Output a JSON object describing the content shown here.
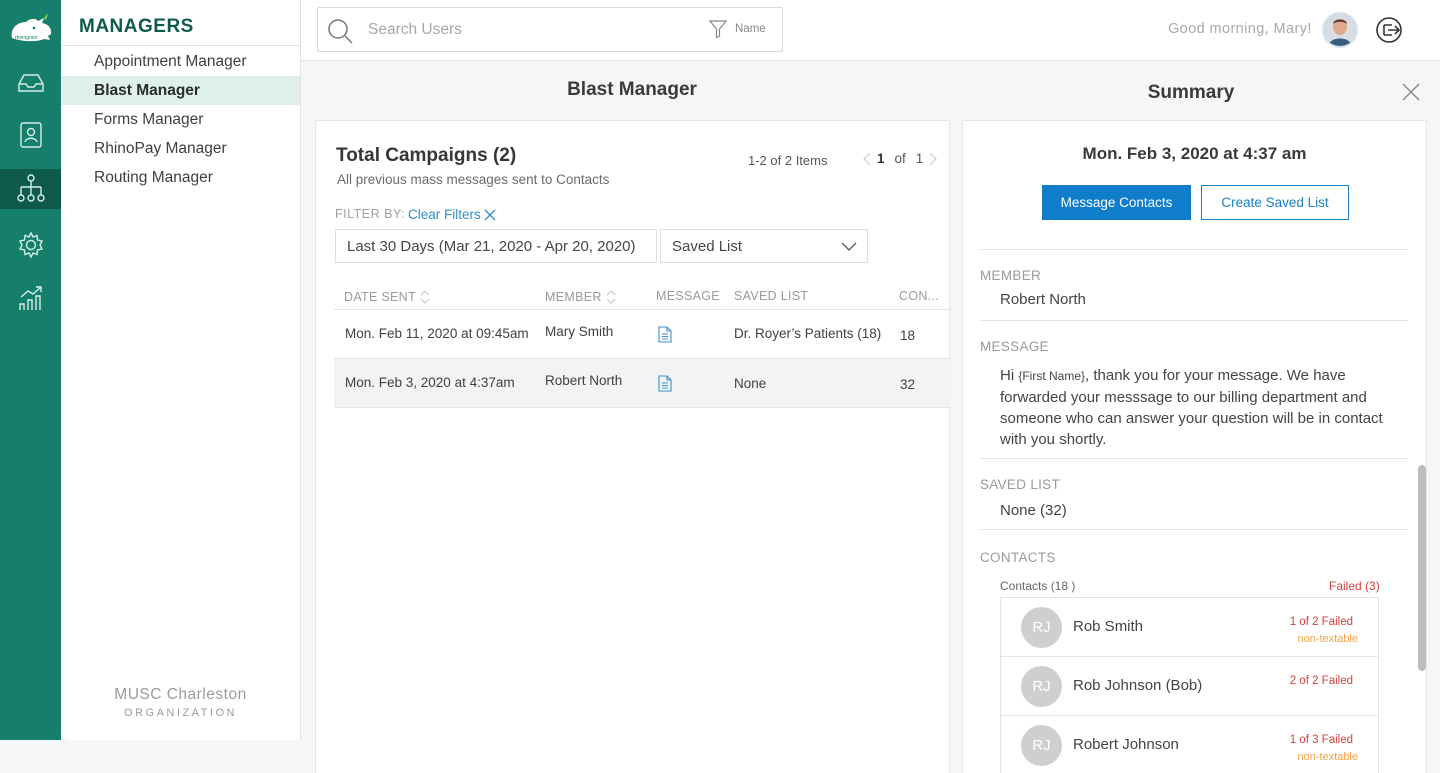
{
  "app": {
    "logo_text": "rhinogram"
  },
  "rail": {
    "items": [
      {
        "icon": "inbox-icon"
      },
      {
        "icon": "contacts-icon"
      },
      {
        "icon": "org-chart-icon",
        "active": true
      },
      {
        "icon": "gear-icon"
      },
      {
        "icon": "analytics-icon"
      }
    ]
  },
  "managers": {
    "title": "MANAGERS",
    "items": [
      {
        "label": "Appointment Manager"
      },
      {
        "label": "Blast Manager",
        "active": true
      },
      {
        "label": "Forms Manager"
      },
      {
        "label": "RhinoPay Manager"
      },
      {
        "label": "Routing Manager"
      }
    ],
    "org_name": "MUSC Charleston",
    "org_label": "ORGANIZATION"
  },
  "header": {
    "search_placeholder": "Search Users",
    "filter_label": "Name",
    "greeting": "Good morning, Mary!"
  },
  "blast": {
    "title": "Blast Manager",
    "card_title": "Total Campaigns (2)",
    "card_subtitle": "All previous mass messages sent to Contacts",
    "pager_text": "1-2 of 2 Items",
    "page_current": "1",
    "page_of": "of",
    "page_total": "1",
    "filter_by": "FILTER BY:",
    "clear_filters": "Clear Filters",
    "date_range": "Last 30 Days (Mar 21, 2020 - Apr 20, 2020)",
    "saved_list_select": "Saved List",
    "columns": {
      "date_sent": "DATE SENT",
      "member": "MEMBER",
      "message": "MESSAGE",
      "saved_list": "SAVED LIST",
      "contacts": "CON..."
    },
    "rows": [
      {
        "date": "Mon. Feb 11, 2020 at 09:45am",
        "member": "Mary Smith",
        "saved_list": "Dr. Royer’s Patients (18)",
        "contacts": "18"
      },
      {
        "date": "Mon. Feb 3, 2020 at 4:37am",
        "member": "Robert North",
        "saved_list": "None",
        "contacts": "32"
      }
    ]
  },
  "summary": {
    "title": "Summary",
    "date": "Mon. Feb 3, 2020 at 4:37 am",
    "message_contacts_btn": "Message Contacts",
    "create_saved_list_btn": "Create Saved List",
    "member_label": "MEMBER",
    "member_value": "Robert North",
    "message_label": "MESSAGE",
    "message_prefix": "Hi ",
    "message_variable": "{First Name}",
    "message_body": ", thank you for your message. We have forwarded your messsage to our billing department and someone who can answer your question will be in contact with you shortly.",
    "saved_list_label": "SAVED LIST",
    "saved_list_value": "None (32)",
    "contacts_label": "CONTACTS",
    "contacts_count": "Contacts (18 )",
    "failed_count": "Failed (3)",
    "contacts": [
      {
        "initials": "RJ",
        "name": "Rob Smith",
        "status": "1 of 2 Failed",
        "note": "non-textable"
      },
      {
        "initials": "RJ",
        "name": "Rob Johnson (Bob)",
        "status": "2 of 2 Failed",
        "note": ""
      },
      {
        "initials": "RJ",
        "name": "Robert Johnson",
        "status": "1 of 3 Failed",
        "note": "non-textable"
      }
    ]
  },
  "colors": {
    "rail": "#167f6b",
    "rail_active": "#0e5b4c",
    "accent": "#0f7dc9",
    "link": "#2f8fc7",
    "failed": "#d0433a",
    "warning": "#f0a347"
  }
}
